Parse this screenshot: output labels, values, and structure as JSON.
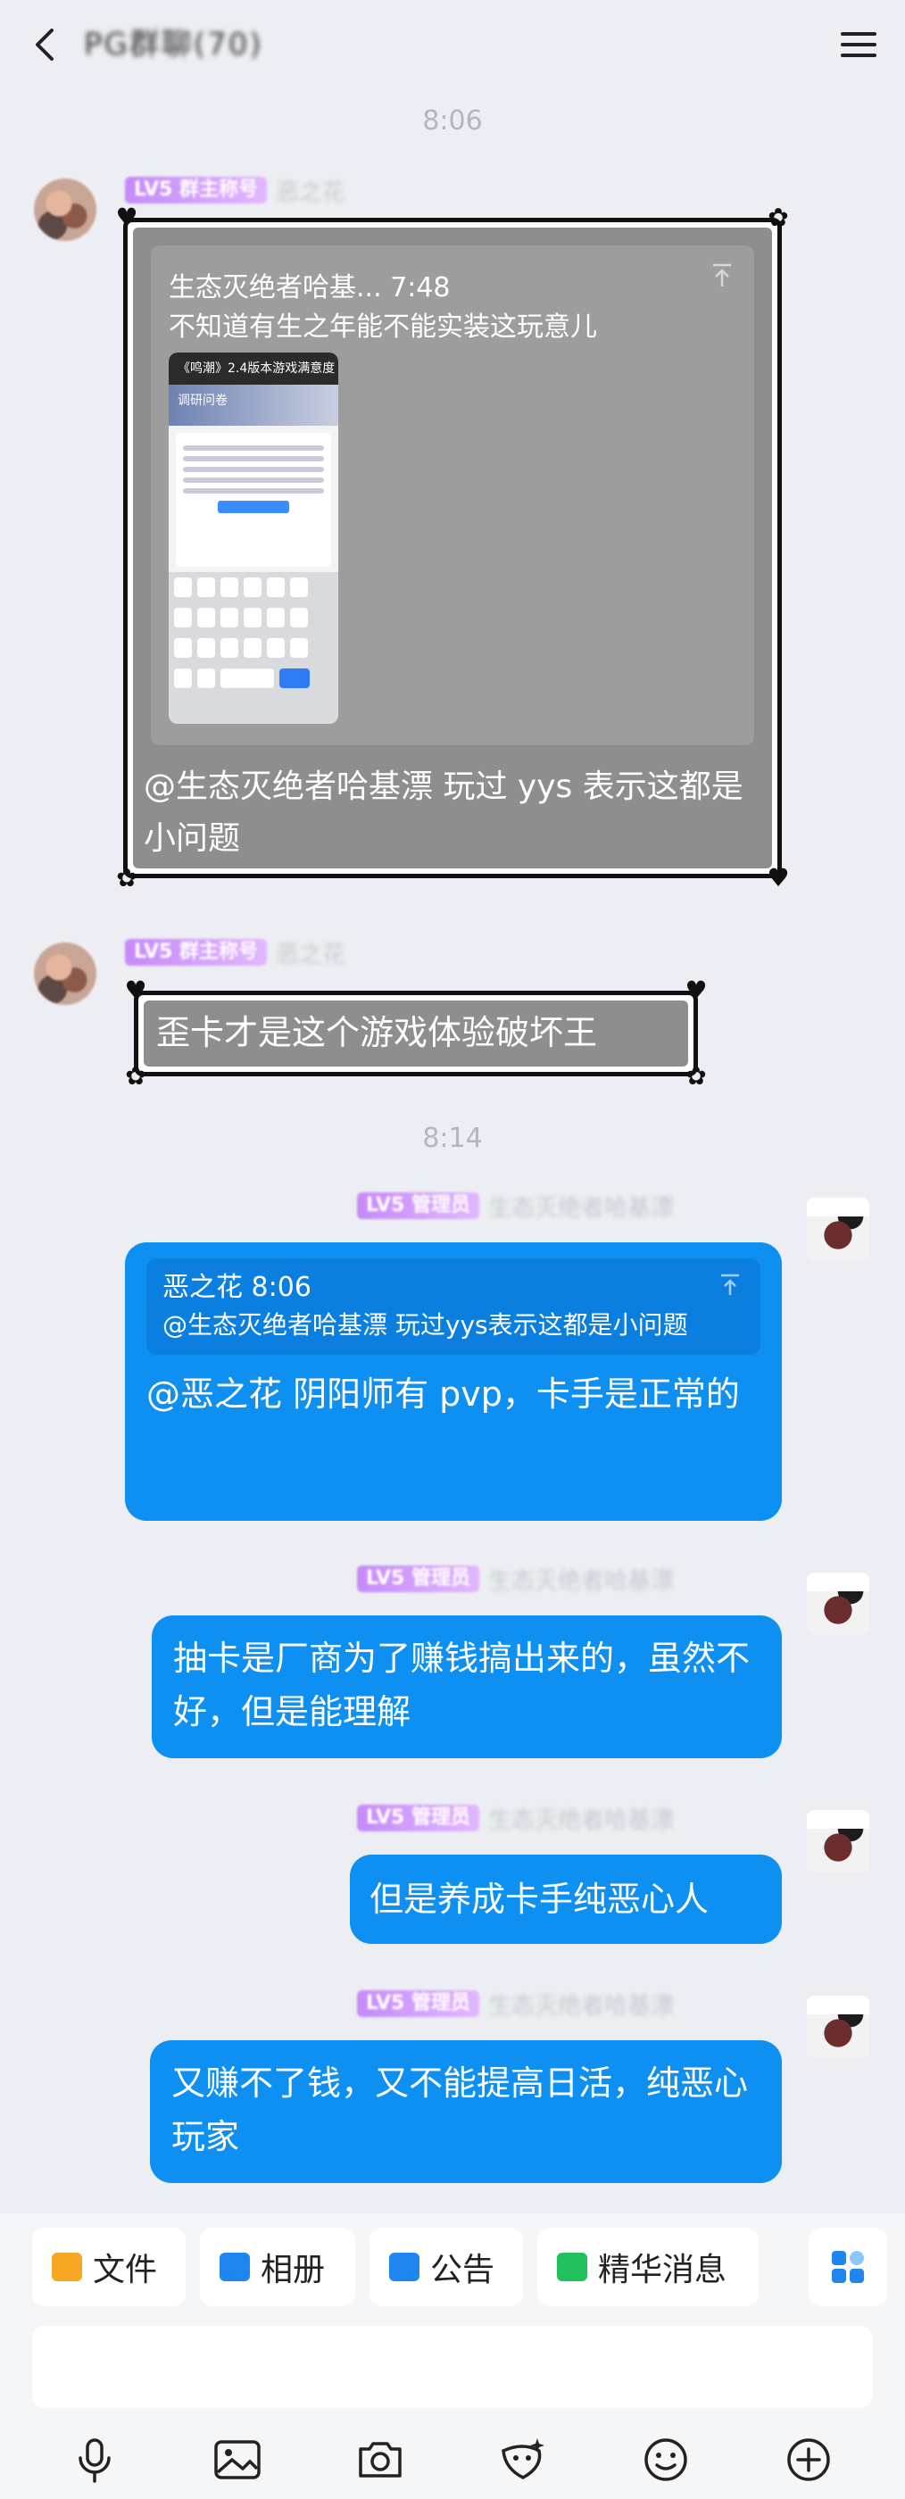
{
  "header": {
    "title": "PG群聊(70)"
  },
  "times": [
    "8:06",
    "8:14"
  ],
  "messages_left": [
    {
      "nick_tag": "LV5 群主称号",
      "nick_name": "恶之花",
      "quote_title": "生态灭绝者哈基... 7:48",
      "quote_line": "不知道有生之年能不能实装这玩意儿",
      "thumb_title": "《鸣潮》2.4版本游戏满意度调研问卷",
      "text": "@生态灭绝者哈基漂 玩过 yys 表示这都是小问题"
    },
    {
      "nick_tag": "LV5 群主称号",
      "nick_name": "恶之花",
      "text": "歪卡才是这个游戏体验破坏王"
    }
  ],
  "messages_right": [
    {
      "nick_tag": "LV5 管理员",
      "nick_name": "生态灭绝者哈基漂",
      "reply_head": "恶之花 8:06",
      "reply_line": "@生态灭绝者哈基漂 玩过yys表示这都是小问题",
      "text": "@恶之花 阴阳师有 pvp，卡手是正常的"
    },
    {
      "nick_tag": "LV5 管理员",
      "nick_name": "生态灭绝者哈基漂",
      "text": "抽卡是厂商为了赚钱搞出来的，虽然不好，但是能理解"
    },
    {
      "nick_tag": "LV5 管理员",
      "nick_name": "生态灭绝者哈基漂",
      "text": "但是养成卡手纯恶心人"
    },
    {
      "nick_tag": "LV5 管理员",
      "nick_name": "生态灭绝者哈基漂",
      "text": "又赚不了钱，又不能提高日活，纯恶心玩家"
    }
  ],
  "bottom": {
    "chips": [
      "文件",
      "相册",
      "公告",
      "精华消息"
    ]
  },
  "colors": {
    "bubble_blue": "#0e8ff2",
    "frame_gray": "#8e8e8e",
    "page_bg": "#eceef3"
  }
}
